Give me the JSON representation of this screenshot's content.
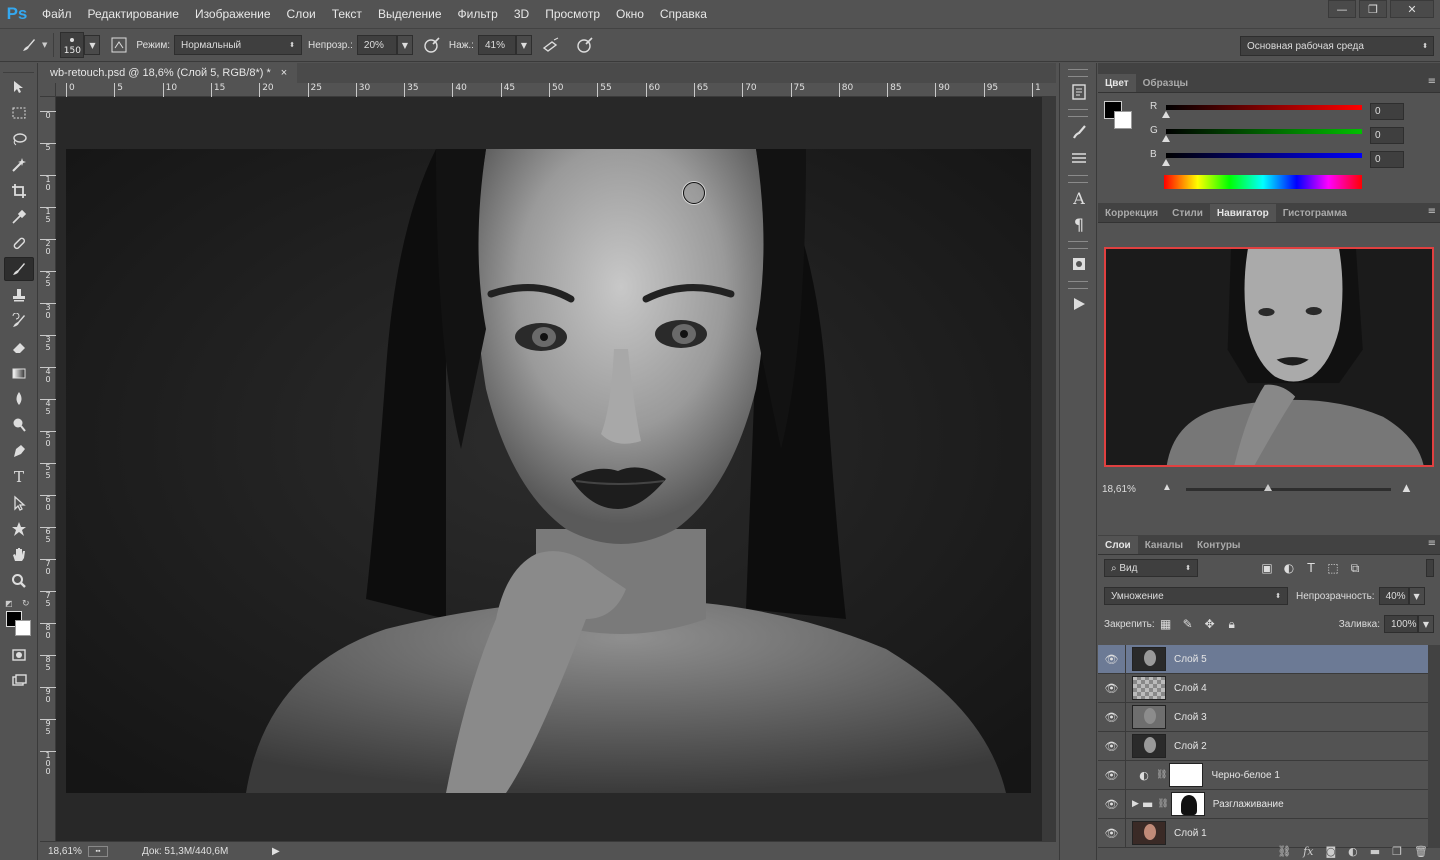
{
  "app": {
    "logo": "Ps"
  },
  "menu": [
    "Файл",
    "Редактирование",
    "Изображение",
    "Слои",
    "Текст",
    "Выделение",
    "Фильтр",
    "3D",
    "Просмотр",
    "Окно",
    "Справка"
  ],
  "window_controls": {
    "minimize": "—",
    "restore": "❐",
    "close": "✕"
  },
  "options": {
    "brush_size": "150",
    "mode_label": "Режим:",
    "mode_value": "Нормальный",
    "opacity_label": "Непрозр.:",
    "opacity_value": "20%",
    "pressure_label": "Наж.:",
    "pressure_value": "41%",
    "workspace": "Основная рабочая среда"
  },
  "document": {
    "tab_title": "wb-retouch.psd @ 18,6% (Слой 5, RGB/8*) *",
    "tab_close": "×",
    "ruler_h": [
      "0",
      "5",
      "10",
      "15",
      "20",
      "25",
      "30",
      "35",
      "40",
      "45",
      "50",
      "55",
      "60",
      "65",
      "70",
      "75",
      "80",
      "85",
      "90",
      "95",
      "1"
    ],
    "ruler_v": [
      "0",
      "5",
      "1 0",
      "1 5",
      "2 0",
      "2 5",
      "3 0",
      "3 5",
      "4 0",
      "4 5",
      "5 0",
      "5 5",
      "6 0",
      "6 5",
      "7 0",
      "7 5",
      "8 0",
      "8 5",
      "9 0",
      "9 5",
      "1 0 0"
    ]
  },
  "status": {
    "zoom": "18,61%",
    "doc_info": "Док: 51,3M/440,6M",
    "arrow": "▶"
  },
  "color_panel": {
    "tabs": [
      "Цвет",
      "Образцы"
    ],
    "channels": [
      {
        "label": "R",
        "value": "0",
        "gradient": "#ff0000"
      },
      {
        "label": "G",
        "value": "0",
        "gradient": "#00c000"
      },
      {
        "label": "B",
        "value": "0",
        "gradient": "#0000ff"
      }
    ]
  },
  "nav_panel": {
    "tabs": [
      "Коррекция",
      "Стили",
      "Навигатор",
      "Гистограмма"
    ],
    "active_tab": "Навигатор",
    "zoom": "18,61%"
  },
  "layers_panel": {
    "tabs": [
      "Слои",
      "Каналы",
      "Контуры"
    ],
    "filter_label": "Вид",
    "blend_mode": "Умножение",
    "opacity_label": "Непрозрачность:",
    "opacity_value": "40%",
    "lock_label": "Закрепить:",
    "fill_label": "Заливка:",
    "fill_value": "100%",
    "layers": [
      {
        "name": "Слой 5",
        "thumb": "photo",
        "selected": true
      },
      {
        "name": "Слой 4",
        "thumb": "transparent",
        "selected": false
      },
      {
        "name": "Слой 3",
        "thumb": "gray",
        "selected": false
      },
      {
        "name": "Слой 2",
        "thumb": "photo",
        "selected": false
      },
      {
        "name": "Черно-белое 1",
        "thumb": "adjustment",
        "selected": false
      },
      {
        "name": "Разглаживание",
        "thumb": "group",
        "selected": false
      },
      {
        "name": "Слой 1",
        "thumb": "color-photo",
        "selected": false
      }
    ]
  }
}
